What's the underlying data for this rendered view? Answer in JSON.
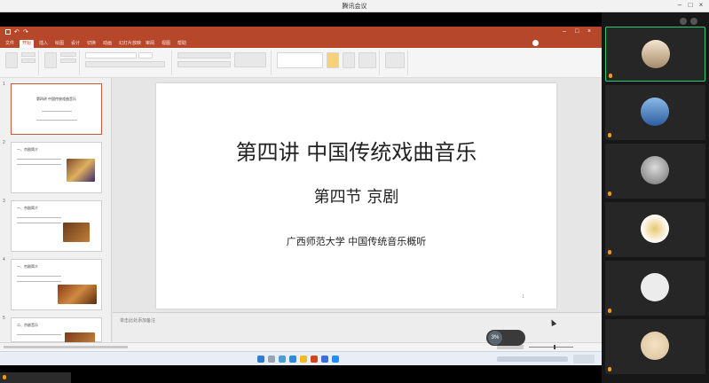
{
  "meeting": {
    "title": "腾讯会议"
  },
  "ppt": {
    "tabs": [
      "文件",
      "开始",
      "插入",
      "绘图",
      "设计",
      "切换",
      "动画",
      "幻灯片放映",
      "审阅",
      "视图",
      "帮助"
    ]
  },
  "thumbnails": [
    {
      "num": "1",
      "title": "第四讲 中国传统戏曲音乐"
    },
    {
      "num": "2",
      "title": "一、京剧简介"
    },
    {
      "num": "3",
      "title": "一、京剧简介"
    },
    {
      "num": "4",
      "title": "一、京剧简介"
    },
    {
      "num": "5",
      "title": "二、京剧音乐"
    }
  ],
  "slide": {
    "title": "第四讲  中国传统戏曲音乐",
    "subtitle": "第四节  京剧",
    "footer": "广西师范大学  中国传统音乐概听",
    "page_number": "1"
  },
  "notes": {
    "placeholder": "单击此处添加备注"
  },
  "record": {
    "label": "3%"
  },
  "participants": [
    {
      "name": "",
      "color": "#c9b49a"
    },
    {
      "name": "",
      "color": "#4a7fc1"
    },
    {
      "name": "",
      "color": "#8c8c8c"
    },
    {
      "name": "",
      "color": "#d9c27a"
    },
    {
      "name": "",
      "color": "#e8e8e8"
    },
    {
      "name": "",
      "color": "#e6d3b3"
    }
  ],
  "colors": {
    "ppt_accent": "#b7472a",
    "active_speaker": "#2ecc71"
  }
}
